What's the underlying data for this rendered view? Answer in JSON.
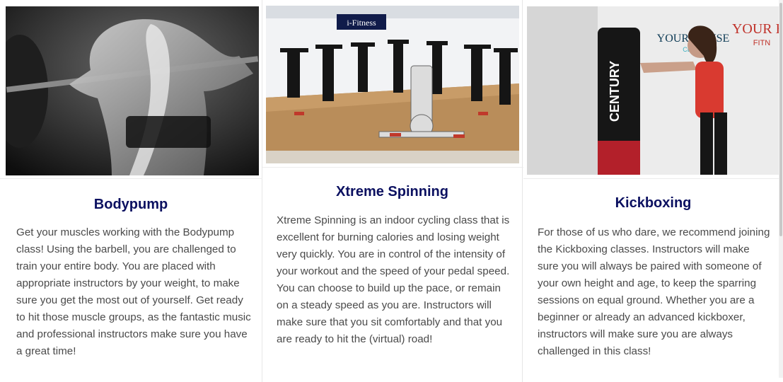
{
  "cards": [
    {
      "image_alt": "Woman lifting a barbell, black and white",
      "title": "Bodypump",
      "body": "Get your muscles working with the Bodypump class! Using the barbell, you are challenged to train your entire body. You are placed with appropriate instructors by your weight, to make sure you get the most out of yourself. Get ready to hit those muscle groups, as the fantastic music and professional instructors make sure you have a great time!"
    },
    {
      "image_alt": "Spinning bikes in a fitness studio",
      "image_sign": "i-Fitness",
      "title": "Xtreme Spinning",
      "body": "Xtreme Spinning is an indoor cycling class that is excellent for burning calories and losing weight very quickly. You are in control of the intensity of your workout and the speed of your pedal speed. You can choose to build up the pace, or remain on a steady speed as you are. Instructors will make sure that you sit comfortably and that you are ready to hit the (virtual) road!"
    },
    {
      "image_alt": "Woman punching a Century boxing bag",
      "image_sign": "YOUR HOUSE",
      "image_sign2": "CLINIC",
      "image_sign3": "YOUR H",
      "image_sign4": "FITN",
      "image_bag_brand": "CENTURY",
      "title": "Kickboxing",
      "body": "For those of us who dare, we recommend joining the Kickboxing classes. Instructors will make sure you will always be paired with someone of your own height and age, to keep the sparring sessions on equal ground. Whether you are a beginner or already an advanced kickboxer, instructors will make sure you are always challenged in this class!"
    }
  ]
}
